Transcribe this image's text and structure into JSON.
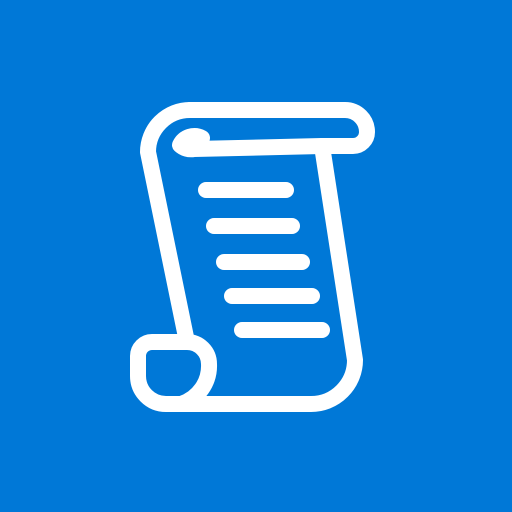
{
  "icon": {
    "name": "scroll-document-icon",
    "background_color": "#0078D7",
    "foreground_color": "#FFFFFF"
  }
}
